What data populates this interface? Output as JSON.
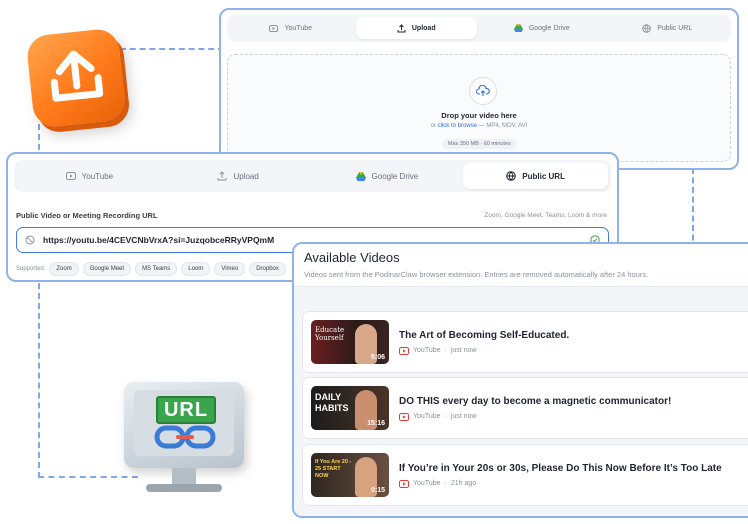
{
  "upload_panel": {
    "tabs": [
      {
        "label": "YouTube",
        "icon": "youtube-icon",
        "active": false
      },
      {
        "label": "Upload",
        "icon": "upload-icon",
        "active": true
      },
      {
        "label": "Google Drive",
        "icon": "google-drive-icon",
        "active": false
      },
      {
        "label": "Public URL",
        "icon": "globe-icon",
        "active": false
      }
    ],
    "drop_title": "Drop your video here",
    "drop_or": "or",
    "browse_link": "click to browse",
    "formats": "— MP4, MOV, AVI",
    "limits": "Max 350 MB · 60 minutes"
  },
  "url_panel": {
    "tabs": [
      {
        "label": "YouTube",
        "icon": "youtube-icon",
        "active": false
      },
      {
        "label": "Upload",
        "icon": "upload-icon",
        "active": false
      },
      {
        "label": "Google Drive",
        "icon": "google-drive-icon",
        "active": false
      },
      {
        "label": "Public URL",
        "icon": "globe-icon",
        "active": true
      }
    ],
    "field_label": "Public Video or Meeting Recording URL",
    "field_hint": "Zoom, Google Meet, Teams, Loom & more",
    "url_value": "https://youtu.be/4CEVCNbVrxA?si=JuzqobceRRyVPQmM",
    "supported_label": "Supported:",
    "supported": [
      "Zoom",
      "Google Meet",
      "MS Teams",
      "Loom",
      "Vimeo",
      "Dropbox"
    ]
  },
  "videos_panel": {
    "title": "Available Videos",
    "subtitle": "Videos sent from the PodinarClaw browser extension. Entries are removed automatically after 24 hours.",
    "items": [
      {
        "title": "The Art of Becoming Self-Educated.",
        "source": "YouTube",
        "age": "just now",
        "duration": "5:06",
        "thumb_text": "Educate Yourself",
        "thumb_color": "#2a1a1a"
      },
      {
        "title": "DO THIS every day to become a magnetic communicator!",
        "source": "YouTube",
        "age": "just now",
        "duration": "15:16",
        "thumb_text": "DAILY HABITS",
        "thumb_color": "#3a2a24"
      },
      {
        "title": "If You’re in Your 20s or 30s, Please Do This Now Before It’s Too Late",
        "source": "YouTube",
        "age": "21h ago",
        "duration": "0:15",
        "thumb_text": "If You Are 20 - 25 START NOW",
        "thumb_color": "#4a3a30"
      }
    ]
  },
  "decor": {
    "url_sign": "URL"
  },
  "colors": {
    "accent": "#3e7be6",
    "card_border": "#8fb2ea",
    "youtube_red": "#e53935",
    "upload_orange": "#ff8a24",
    "url_green": "#3aa64b"
  }
}
